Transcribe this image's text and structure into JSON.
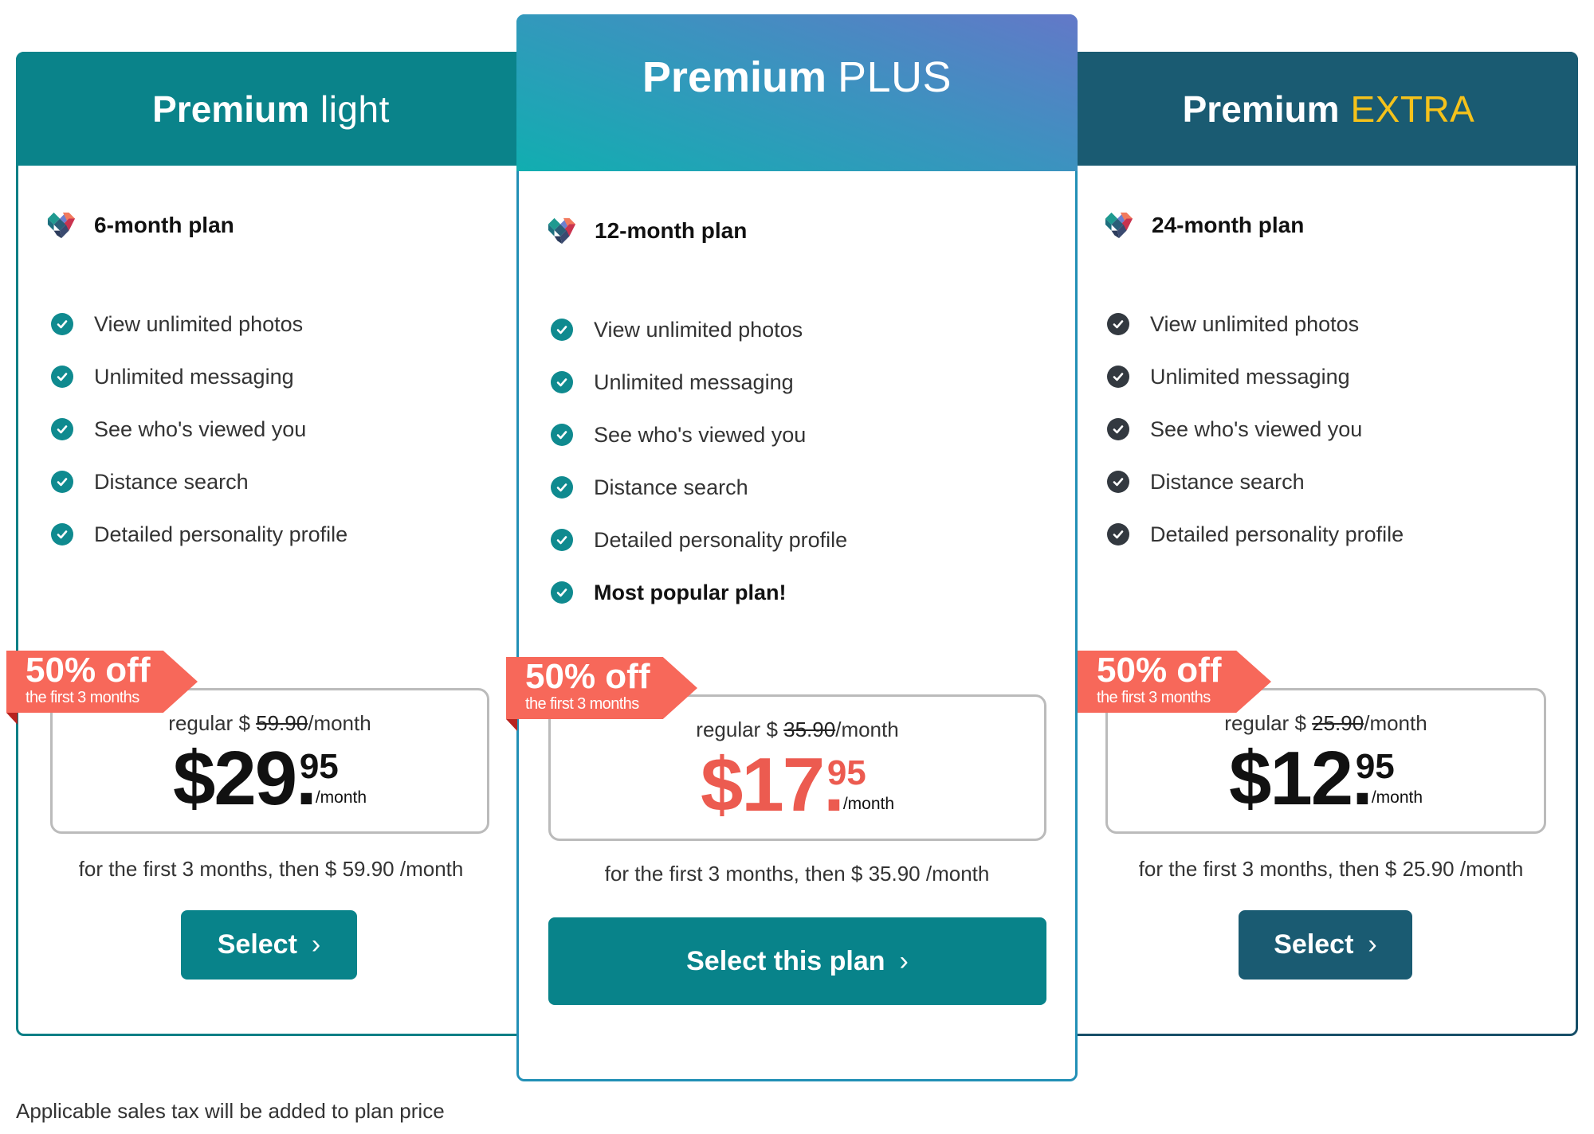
{
  "plans": [
    {
      "title_strong": "Premium",
      "title_light": "light",
      "plan_label": "6-month plan",
      "features": [
        "View unlimited photos",
        "Unlimited messaging",
        "See who's viewed you",
        "Distance search",
        "Detailed personality profile"
      ],
      "ribbon_big": "50% off",
      "ribbon_small": "the first 3 months",
      "regular_prefix": "regular $",
      "regular_price": "59.90",
      "regular_suffix": "/month",
      "price_main": "$29",
      "price_cents": "95",
      "price_per": "/month",
      "then_text": "for the first 3 months, then $ 59.90 /month",
      "button_label": "Select",
      "button_chevron": "›",
      "header_color": "#0a838a"
    },
    {
      "title_strong": "Premium",
      "title_light": "PLUS",
      "plan_label": "12-month plan",
      "features": [
        "View unlimited photos",
        "Unlimited messaging",
        "See who's viewed you",
        "Distance search",
        "Detailed personality profile"
      ],
      "highlight_feature": "Most popular plan!",
      "ribbon_big": "50% off",
      "ribbon_small": "the first 3 months",
      "regular_prefix": "regular $",
      "regular_price": "35.90",
      "regular_suffix": "/month",
      "price_main": "$17",
      "price_cents": "95",
      "price_per": "/month",
      "then_text": "for the first 3 months, then $ 35.90 /month",
      "button_label": "Select this plan",
      "button_chevron": "›",
      "price_color": "#ec5b50"
    },
    {
      "title_strong": "Premium",
      "title_light": "EXTRA",
      "plan_label": "24-month plan",
      "features": [
        "View unlimited photos",
        "Unlimited messaging",
        "See who's viewed you",
        "Distance search",
        "Detailed personality profile"
      ],
      "ribbon_big": "50% off",
      "ribbon_small": "the first 3 months",
      "regular_prefix": "regular $",
      "regular_price": "25.90",
      "regular_suffix": "/month",
      "price_main": "$12",
      "price_cents": "95",
      "price_per": "/month",
      "then_text": "for the first 3 months, then $ 25.90 /month",
      "button_label": "Select",
      "button_chevron": "›",
      "header_color": "#1a5b72",
      "accent_color": "#f5c21b"
    }
  ],
  "footer_note": "Applicable sales tax will be added to plan price",
  "icons": {
    "plan_icon": "heart-logo-icon",
    "feature_icon": "check-circle-icon",
    "button_icon": "chevron-right-icon"
  }
}
